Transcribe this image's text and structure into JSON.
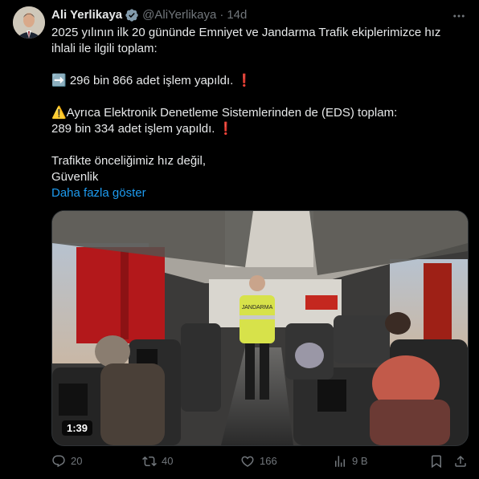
{
  "tweet": {
    "author_name": "Ali Yerlikaya",
    "handle": "@AliYerlikaya",
    "separator": "·",
    "time": "14d",
    "lines": [
      "2025 yılının ilk 20 gününde Emniyet ve Jandarma Trafik ekiplerimizce hız",
      "ihlali ile ilgili toplam:",
      "➡️ 296 bin 866 adet işlem yapıldı. ❗",
      "⚠️Ayrıca Elektronik Denetleme Sistemlerinden de (EDS) toplam:",
      "289 bin 334 adet işlem yapıldı. ❗",
      "Trafikte önceliğimiz hız değil,",
      "Güvenlik"
    ],
    "show_more": "Daha fazla göster",
    "video_duration": "1:39",
    "vest_text": "JANDARMA",
    "stats": {
      "replies": "20",
      "reposts": "40",
      "likes": "166",
      "views": "9 B"
    }
  },
  "colors": {
    "background": "#000000",
    "text": "#e7e9ea",
    "muted": "#71767b",
    "link": "#1d9bf0",
    "verified_badge": "#829aab"
  },
  "icons": [
    "verified-icon",
    "more-icon",
    "reply-icon",
    "repost-icon",
    "like-icon",
    "views-icon",
    "bookmark-icon",
    "share-icon"
  ]
}
